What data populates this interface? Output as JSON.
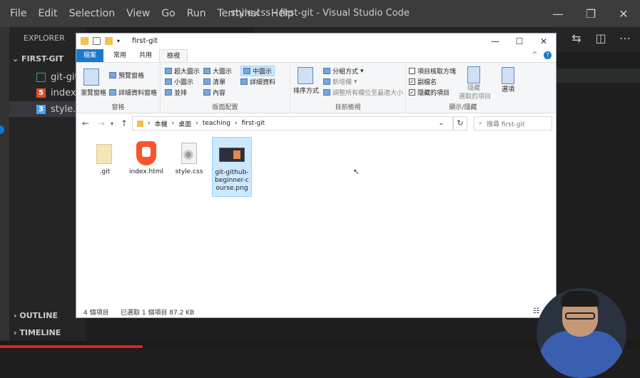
{
  "vscode": {
    "menu": [
      "File",
      "Edit",
      "Selection",
      "View",
      "Go",
      "Run",
      "Terminal",
      "Help"
    ],
    "window_title": "style.css - first-git - Visual Studio Code",
    "window_controls": {
      "minimize": "—",
      "restore": "❐",
      "close": "✕"
    },
    "explorer_header": "EXPLORER",
    "folder": "FIRST-GIT",
    "files": [
      {
        "label": "git-git",
        "icon": "image-file-icon",
        "color": "#26a69a"
      },
      {
        "label": "index.",
        "icon": "html-file-icon",
        "color": "#e44d26"
      },
      {
        "label": "style.c",
        "icon": "css-file-icon",
        "color": "#42a5f5"
      }
    ],
    "outline": "OUTLINE",
    "timeline": "TIMELINE"
  },
  "explorer_window": {
    "title": "first-git",
    "controls": {
      "minimize": "—",
      "maximize": "☐",
      "close": "✕"
    },
    "ribbon_tabs": [
      "檔案",
      "常用",
      "共用",
      "檢視"
    ],
    "ribbon": {
      "panes": {
        "nav_pane": "瀏覽窗格",
        "preview": "預覽窗格",
        "details": "詳細資料窗格",
        "label": "窗格"
      },
      "layout": {
        "items": [
          "超大圖示",
          "大圖示",
          "中圖示",
          "小圖示",
          "清單",
          "詳細資料",
          "並排",
          "內容"
        ],
        "label": "版面配置"
      },
      "current_view": {
        "sort": "排序方式",
        "group_by": "分組方式",
        "add_column": "新增欄",
        "fit_columns": "調整所有欄位至最適大小",
        "label": "目前檢視"
      },
      "show_hide": {
        "item_checkboxes": "項目核取方塊",
        "extensions": "副檔名",
        "hidden_items": "隱藏的項目",
        "hide_selected_1": "隱藏",
        "hide_selected_2": "選取的項目",
        "options": "選項",
        "label": "顯示/隱藏"
      }
    },
    "breadcrumb": [
      "本機",
      "桌面",
      "teaching",
      "first-git"
    ],
    "search_placeholder": "搜尋 first-git",
    "files": [
      {
        "name": ".git",
        "type": "folder"
      },
      {
        "name": "index.html",
        "type": "brave"
      },
      {
        "name": "style.css",
        "type": "css"
      },
      {
        "name": "git-github-beginner-course.png",
        "type": "image"
      }
    ],
    "status": {
      "count": "4 個項目",
      "selected": "已選取 1 個項目 87.2 KB"
    }
  }
}
